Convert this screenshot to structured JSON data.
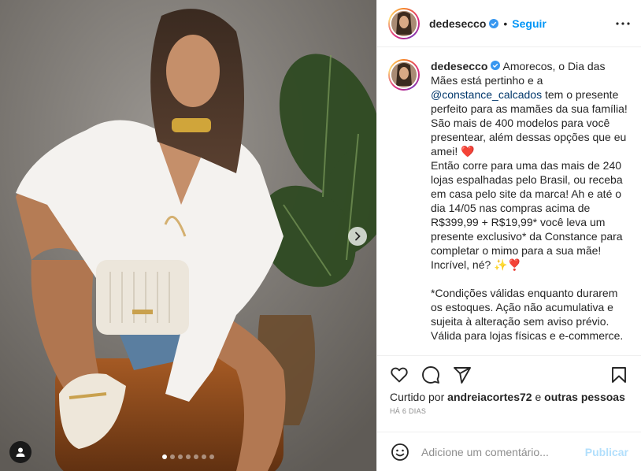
{
  "post": {
    "username": "dedesecco",
    "follow_label": "Seguir",
    "separator": "•",
    "carousel": {
      "count": 7,
      "active_index": 0
    }
  },
  "caption": {
    "username": "dedesecco",
    "part1": "Amorecos, o Dia das Mães está pertinho e a ",
    "mention": "@constance_calcados",
    "part2": " tem o presente perfeito para as mamães da sua família! São mais de 400 modelos para você presentear, além dessas opções que eu amei! ❤️\nEntão corre para uma das mais de 240 lojas espalhadas pelo Brasil, ou receba em casa pelo site da marca! Ah e até o dia 14/05 nas compras acima de R$399,99 + R$19,99* você leva um presente exclusivo* da Constance para completar o mimo para a sua mãe! Incrível, né? ✨❣️\n\n*Condições válidas enquanto durarem os estoques. Ação não acumulativa e sujeita à alteração sem aviso prévio. Válida para lojas físicas e e-commerce."
  },
  "likes": {
    "prefix": "Curtido por ",
    "user": "andreiacortes72",
    "middle": " e ",
    "others": "outras pessoas"
  },
  "time_ago": "HÁ 6 DIAS",
  "comment_box": {
    "placeholder": "Adicione um comentário...",
    "publish_label": "Publicar"
  },
  "icons": {
    "verified": "verified-badge-icon",
    "more": "more-options-icon",
    "like": "heart-icon",
    "comment": "comment-icon",
    "share": "share-icon",
    "save": "bookmark-icon",
    "emoji": "emoji-icon",
    "next": "chevron-right-icon",
    "tag": "user-tag-icon"
  },
  "colors": {
    "accent": "#0095f6",
    "publish_disabled": "#b2dffc",
    "verified": "#3897f0",
    "muted": "#8e8e8e"
  }
}
